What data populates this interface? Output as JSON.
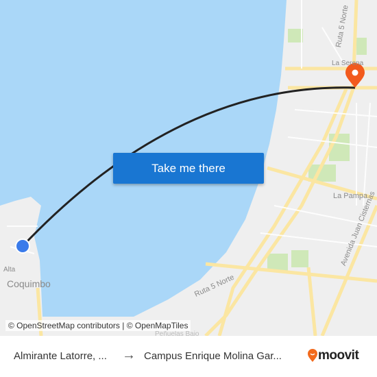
{
  "map": {
    "labels": {
      "la_serena": "La Serena",
      "ruta5_top": "Ruta 5 Norte",
      "ruta5_bottom": "Ruta 5 Norte",
      "la_pampa": "La Pampa",
      "juan_cisternas": "Avenida Juan Cisternas",
      "coquimbo": "Coquimbo",
      "alta": "Alta",
      "penuelas": "Peñuelas Bajo"
    },
    "attribution": "© OpenStreetMap contributors | © OpenMapTiles",
    "colors": {
      "water": "#aad7f8",
      "land": "#efefef",
      "road": "#fbe6a2",
      "park": "#cfe8b8",
      "route": "#222222",
      "origin": "#3a7bea",
      "destination": "#f25a1d"
    }
  },
  "cta": {
    "label": "Take me there"
  },
  "footer": {
    "from": "Almirante Latorre, ...",
    "arrow": "→",
    "to": "Campus Enrique Molina Gar...",
    "brand": "moovit"
  }
}
